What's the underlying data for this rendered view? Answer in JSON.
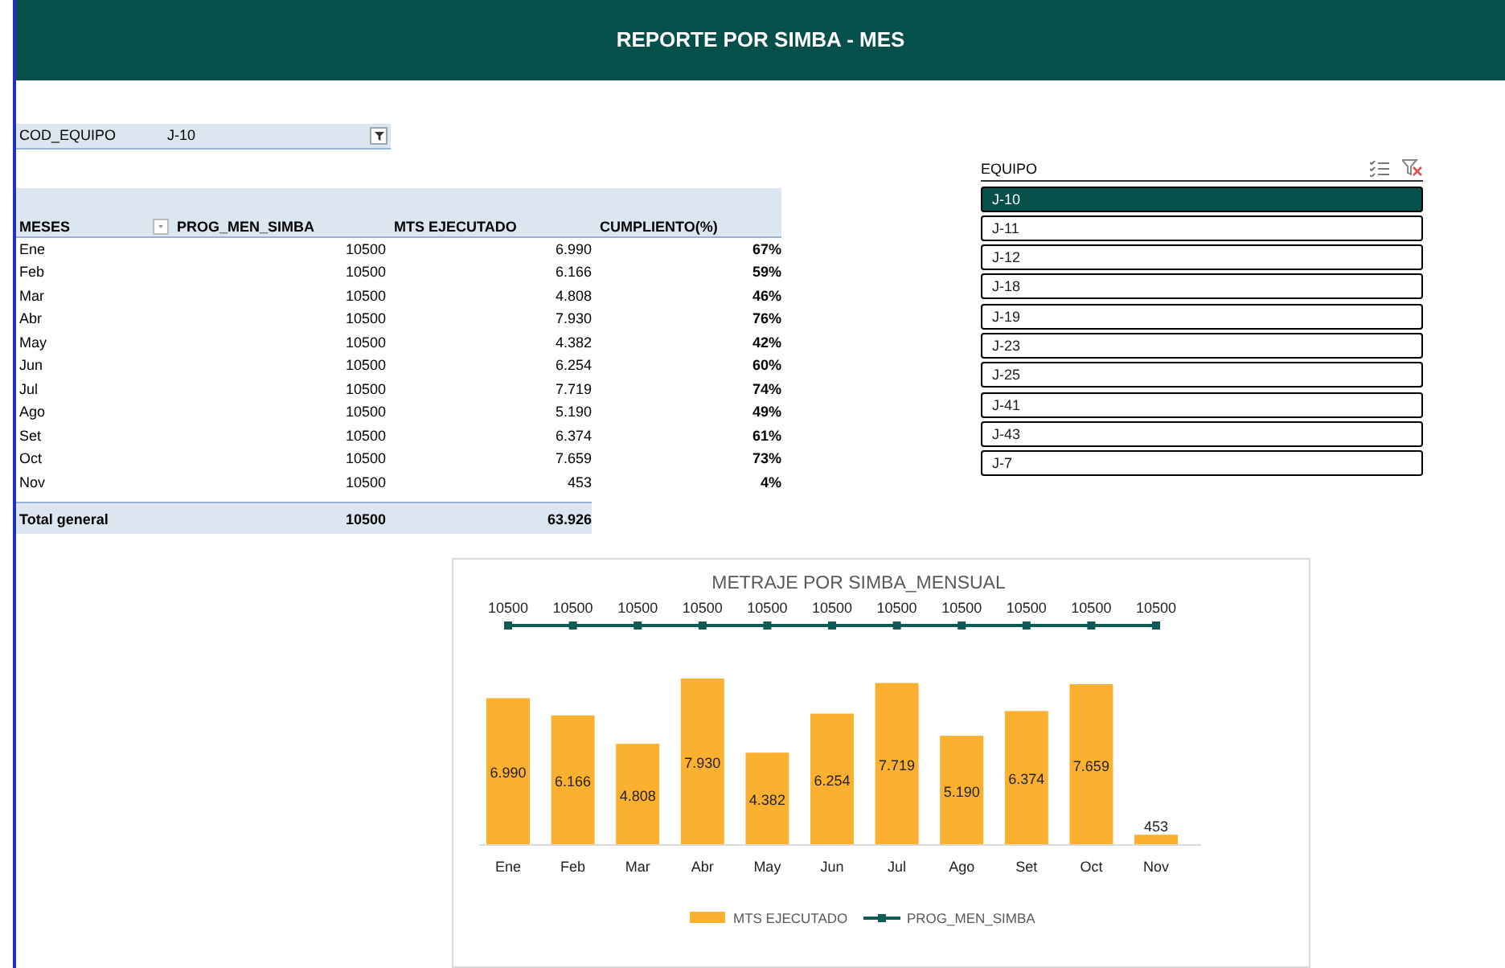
{
  "header": {
    "title": "REPORTE POR SIMBA - MES"
  },
  "report_filter": {
    "field": "COD_EQUIPO",
    "value": "J-10"
  },
  "pivot": {
    "columns": [
      "MESES",
      "PROG_MEN_SIMBA",
      "MTS EJECUTADO",
      "CUMPLIENTO(%)"
    ],
    "rows": [
      {
        "mes": "Ene",
        "prog": "10500",
        "mts": "6.990",
        "cumplimiento": "67%"
      },
      {
        "mes": "Feb",
        "prog": "10500",
        "mts": "6.166",
        "cumplimiento": "59%"
      },
      {
        "mes": "Mar",
        "prog": "10500",
        "mts": "4.808",
        "cumplimiento": "46%"
      },
      {
        "mes": "Abr",
        "prog": "10500",
        "mts": "7.930",
        "cumplimiento": "76%"
      },
      {
        "mes": "May",
        "prog": "10500",
        "mts": "4.382",
        "cumplimiento": "42%"
      },
      {
        "mes": "Jun",
        "prog": "10500",
        "mts": "6.254",
        "cumplimiento": "60%"
      },
      {
        "mes": "Jul",
        "prog": "10500",
        "mts": "7.719",
        "cumplimiento": "74%"
      },
      {
        "mes": "Ago",
        "prog": "10500",
        "mts": "5.190",
        "cumplimiento": "49%"
      },
      {
        "mes": "Set",
        "prog": "10500",
        "mts": "6.374",
        "cumplimiento": "61%"
      },
      {
        "mes": "Oct",
        "prog": "10500",
        "mts": "7.659",
        "cumplimiento": "73%"
      },
      {
        "mes": "Nov",
        "prog": "10500",
        "mts": "453",
        "cumplimiento": "4%"
      }
    ],
    "total": {
      "label": "Total general",
      "prog": "10500",
      "mts": "63.926"
    }
  },
  "slicer": {
    "title": "EQUIPO",
    "items": [
      {
        "label": "J-10",
        "selected": true
      },
      {
        "label": "J-11",
        "selected": false
      },
      {
        "label": "J-12",
        "selected": false
      },
      {
        "label": "J-18",
        "selected": false
      },
      {
        "label": "J-19",
        "selected": false
      },
      {
        "label": "J-23",
        "selected": false
      },
      {
        "label": "J-25",
        "selected": false
      },
      {
        "label": "J-41",
        "selected": false
      },
      {
        "label": "J-43",
        "selected": false
      },
      {
        "label": "J-7",
        "selected": false
      }
    ]
  },
  "chart": {
    "chart_data": {
      "type": "bar",
      "title": "METRAJE POR SIMBA_MENSUAL",
      "categories": [
        "Ene",
        "Feb",
        "Mar",
        "Abr",
        "May",
        "Jun",
        "Jul",
        "Ago",
        "Set",
        "Oct",
        "Nov"
      ],
      "series": [
        {
          "name": "MTS EJECUTADO",
          "color": "#fbb12f",
          "type": "bar",
          "values": [
            6990,
            6166,
            4808,
            7930,
            4382,
            6254,
            7719,
            5190,
            6374,
            7659,
            453
          ],
          "value_labels": [
            "6.990",
            "6.166",
            "4.808",
            "7.930",
            "4.382",
            "6.254",
            "7.719",
            "5.190",
            "6.374",
            "7.659",
            "453"
          ]
        },
        {
          "name": "PROG_MEN_SIMBA",
          "color": "#0e5a55",
          "type": "line",
          "marker": "square",
          "values": [
            10500,
            10500,
            10500,
            10500,
            10500,
            10500,
            10500,
            10500,
            10500,
            10500,
            10500
          ],
          "value_labels": [
            "10500",
            "10500",
            "10500",
            "10500",
            "10500",
            "10500",
            "10500",
            "10500",
            "10500",
            "10500",
            "10500"
          ]
        }
      ],
      "legend": "bottom",
      "data_labels": true
    }
  }
}
